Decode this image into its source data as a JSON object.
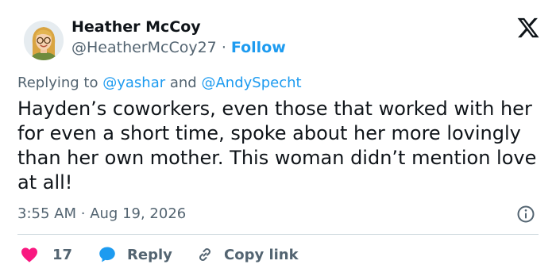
{
  "author": {
    "name": "Heather McCoy",
    "handle": "@HeatherMcCoy27",
    "separator": "·",
    "follow_label": "Follow",
    "avatar_icon": "memoji-avatar"
  },
  "reply_context": {
    "prefix": "Replying to",
    "mention1": "@yashar",
    "conjunction": "and",
    "mention2": "@AndySpecht"
  },
  "tweet": {
    "text": "Hayden’s coworkers, even those that worked with her for even a short time, spoke about her more lovingly than her own mother. This woman didn’t mention love at all!"
  },
  "meta": {
    "time": "3:55 AM",
    "separator": "·",
    "date": "Aug 19, 2026"
  },
  "actions": {
    "like_count": "17",
    "reply_label": "Reply",
    "copy_label": "Copy link"
  },
  "colors": {
    "accent": "#1d9bf0",
    "like": "#f91880",
    "muted": "#536471",
    "text": "#0f1419"
  }
}
